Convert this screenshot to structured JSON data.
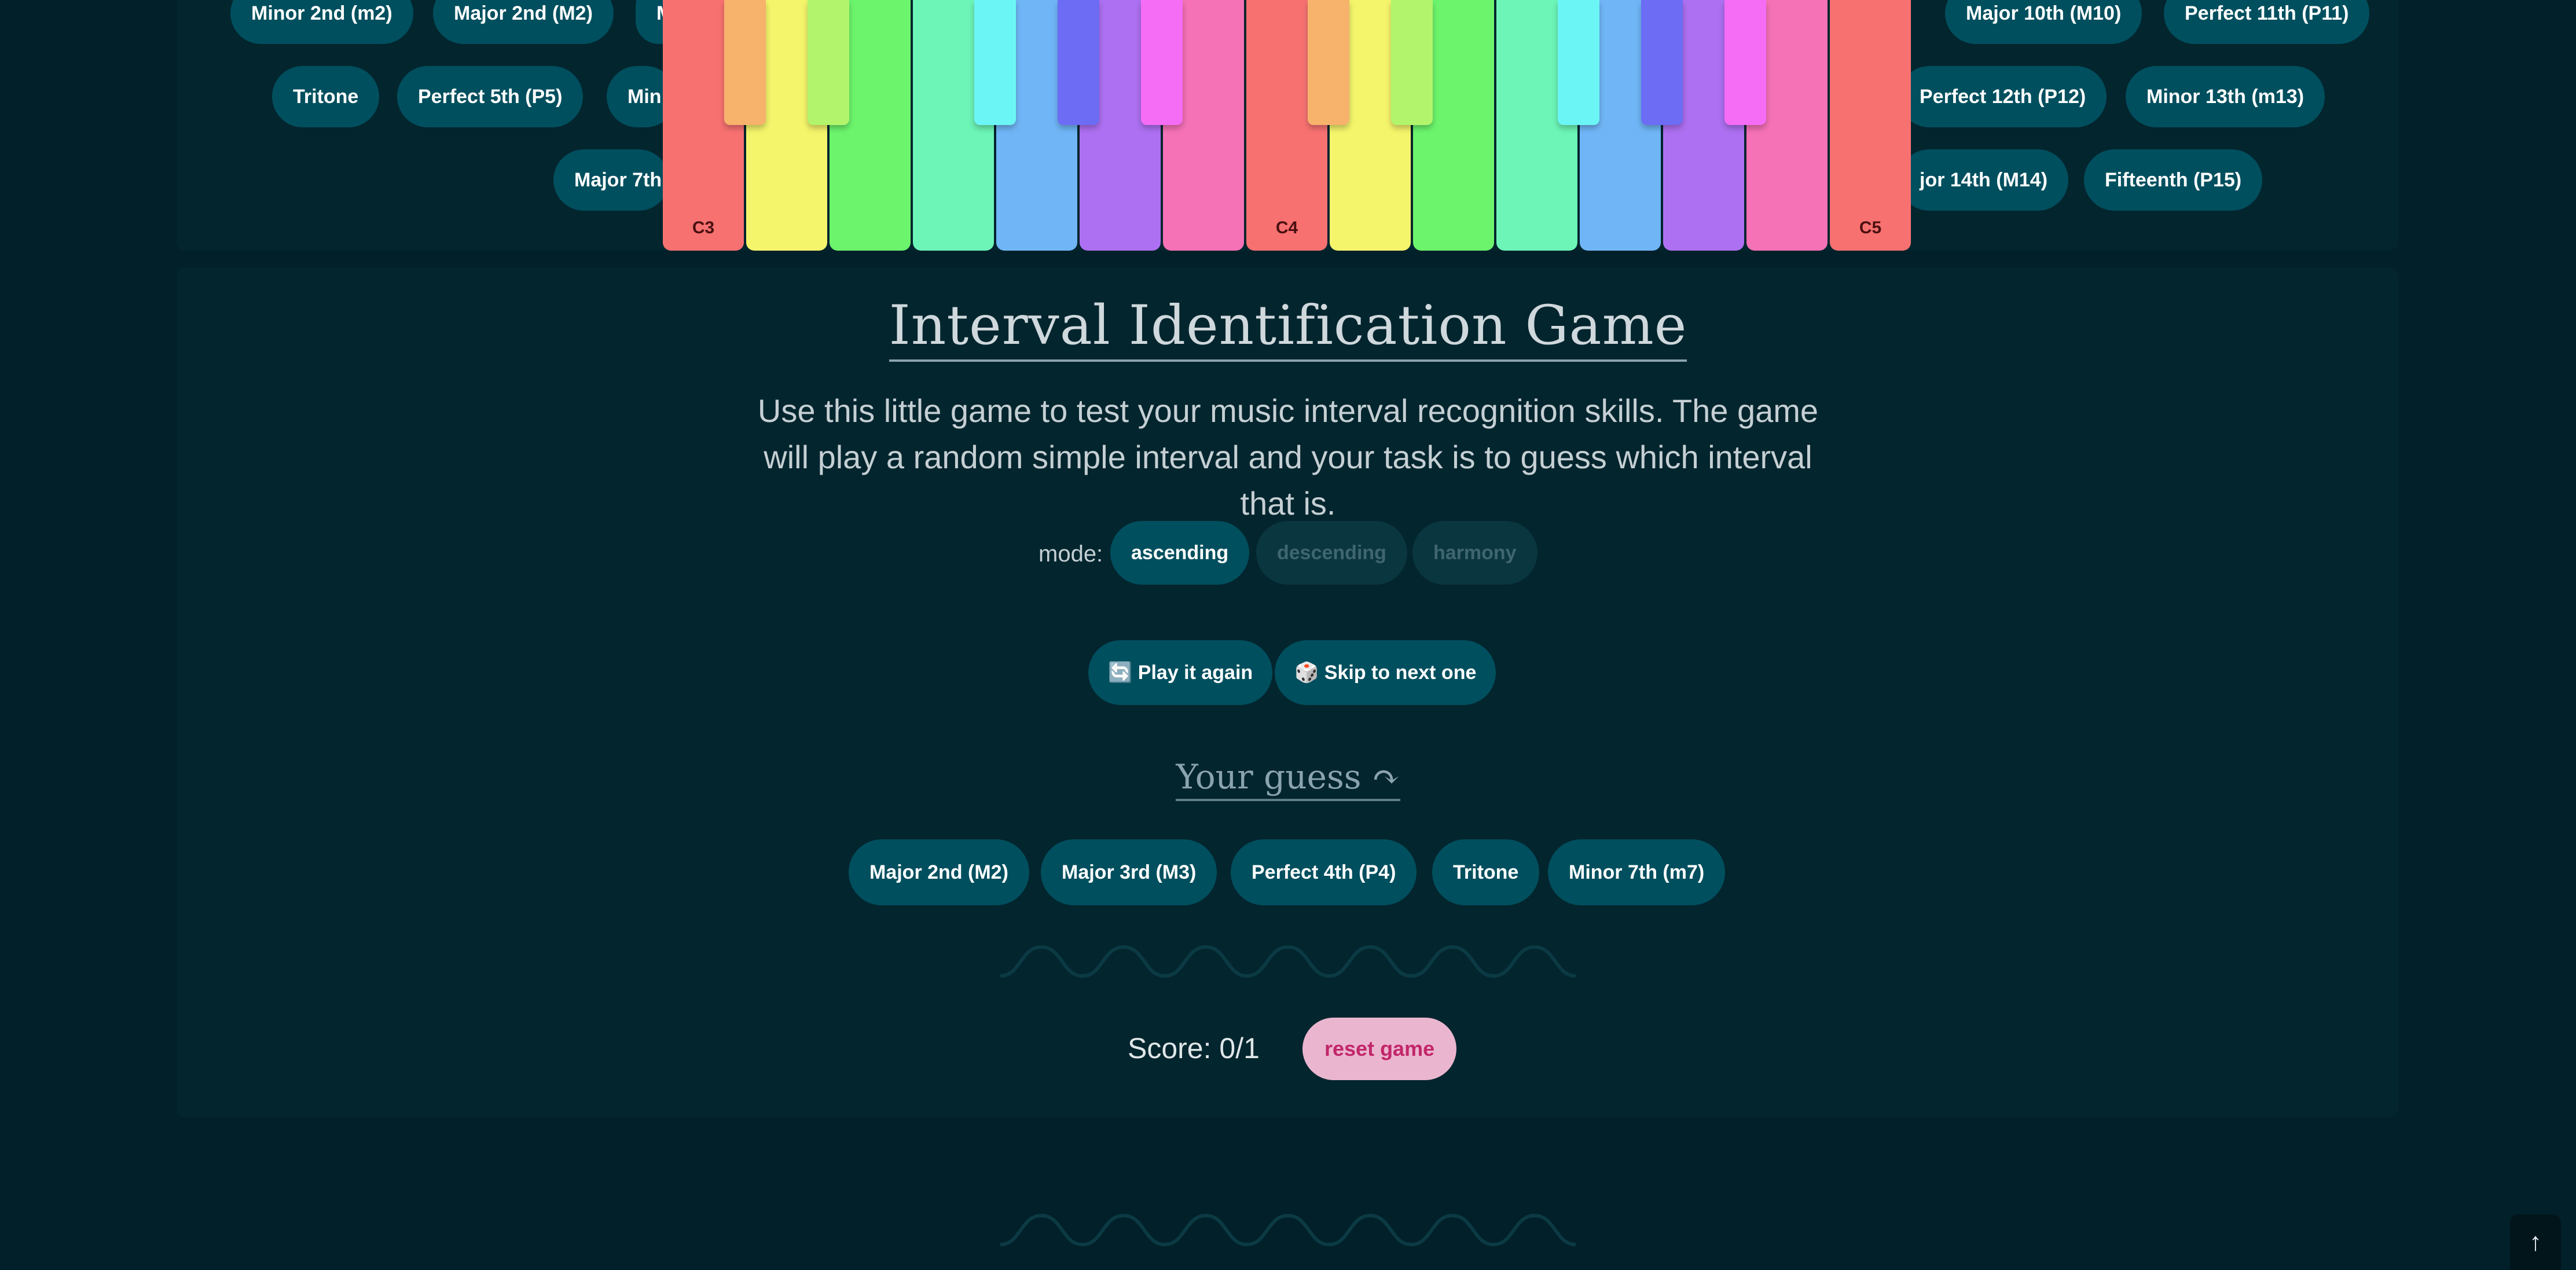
{
  "interval_buttons_top": [
    "Minor 2nd (m2)",
    "Major 2nd (M2)",
    "M",
    "Major 10th (M10)",
    "Perfect 11th (P11)",
    "Tritone",
    "Perfect 5th (P5)",
    "Min",
    "Perfect 12th (P12)",
    "Minor 13th (m13)",
    "Major 7th",
    "jor 14th (M14)",
    "Fifteenth (P15)"
  ],
  "piano": {
    "notes": [
      "C3",
      "C4",
      "C5"
    ],
    "white_key_colors": [
      "#f87171",
      "#f5f56c",
      "#6cf56c",
      "#6cf5b7",
      "#70b6f7",
      "#ae70f2",
      "#f572b6",
      "#f87171",
      "#f5f56c",
      "#6cf56c",
      "#6cf5b7",
      "#70b6f7",
      "#ae70f2",
      "#f572b6",
      "#f87171"
    ],
    "black_key_colors": [
      "#f7b26c",
      "#b2f56c",
      "#6cf5f5",
      "#6c6cf5",
      "#f56cf5",
      "#f7b26c",
      "#b2f56c",
      "#6cf5f5",
      "#6c6cf5",
      "#f56cf5"
    ]
  },
  "game": {
    "title": "Interval Identification Game",
    "intro": "Use this little game to test your music interval recognition skills. The game will play a random simple interval and your task is to guess which interval that is.",
    "mode_label": "mode:",
    "modes": [
      "ascending",
      "descending",
      "harmony"
    ],
    "selected_mode": "ascending",
    "play_again": "🔄 Play it again",
    "skip": "🎲 Skip to next one",
    "guess_heading": "Your guess ↷",
    "guesses": [
      "Major 2nd (M2)",
      "Major 3rd (M3)",
      "Perfect 4th (P4)",
      "Tritone",
      "Minor 7th (m7)"
    ],
    "score": "Score: 0/1",
    "reset": "reset game"
  },
  "icons": {
    "scroll_top": "arrow-up-icon"
  },
  "colors": {
    "background": "#022029",
    "panel": "#03252e",
    "button": "#004f5e",
    "reset_bg": "#eab6cf",
    "reset_text": "#c2266a"
  }
}
